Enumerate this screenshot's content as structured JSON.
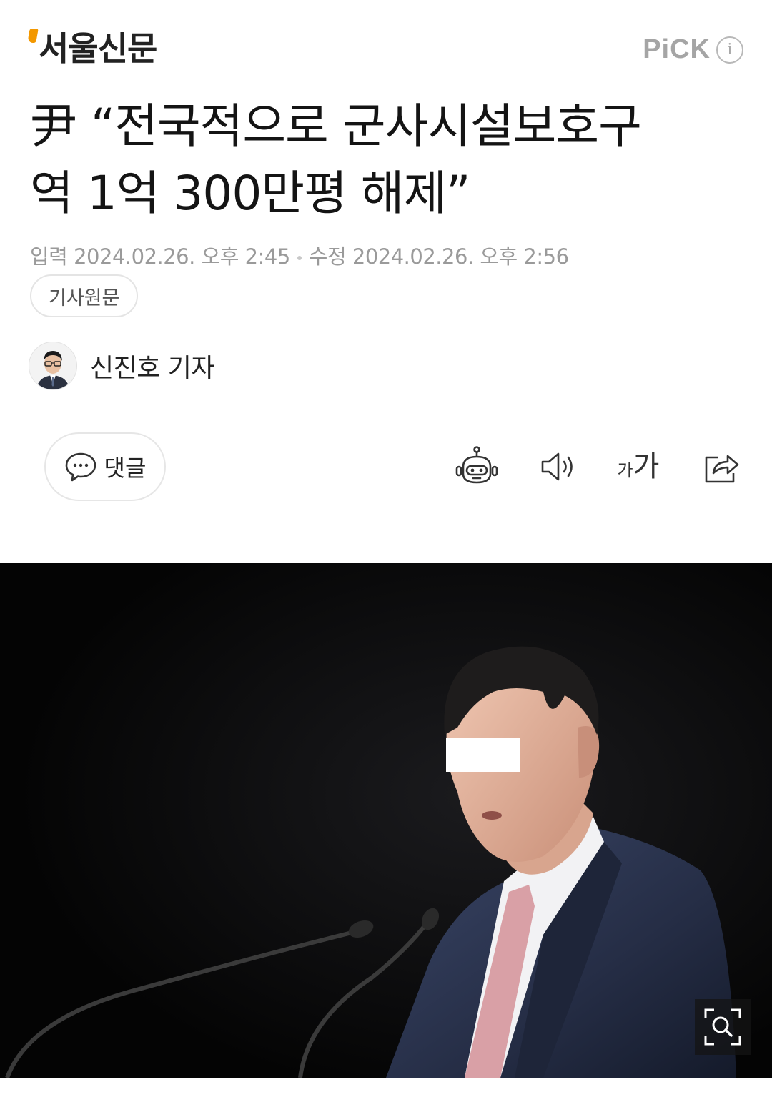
{
  "header": {
    "logo_text": "서울신문",
    "pick_label": "PiCK",
    "info_icon": "info-icon"
  },
  "article": {
    "headline_line1": "尹 “전국적으로 군사시설보호구",
    "headline_line2": "역 1억 300만평 해제”",
    "meta": {
      "published_label": "입력",
      "published_value": "2024.02.26. 오후 2:45",
      "modified_label": "수정",
      "modified_value": "2024.02.26. 오후 2:56"
    },
    "source_button_label": "기사원문",
    "reporter": "신진호 기자"
  },
  "actions": {
    "comment_label": "댓글",
    "font_size_small": "가",
    "font_size_large": "가",
    "icons": [
      "comment-icon",
      "robot-summary-icon",
      "speaker-icon",
      "font-size-icon",
      "share-icon",
      "zoom-search-icon"
    ]
  },
  "colors": {
    "logo_accent": "#f39800",
    "text": "#141414",
    "meta": "#9a9a9a",
    "photo_bg": "#060606"
  }
}
